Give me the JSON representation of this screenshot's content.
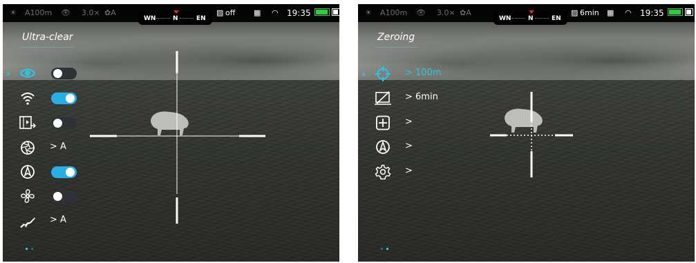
{
  "left": {
    "status": {
      "range": "A100m",
      "zoom": "3.0×",
      "mode": "A",
      "compass": [
        "WN",
        "N",
        "EN"
      ],
      "display_off": "off",
      "time": "19:35"
    },
    "menu_title": "Ultra-clear",
    "rows": [
      {
        "icon": "eye-icon",
        "toggle": "off",
        "selected": true
      },
      {
        "icon": "wifi-icon",
        "toggle": "on"
      },
      {
        "icon": "pip-icon",
        "toggle": "off"
      },
      {
        "icon": "aperture-icon",
        "value": "> A"
      },
      {
        "icon": "compass-icon",
        "toggle": "on"
      },
      {
        "icon": "fan-icon",
        "toggle": "off"
      },
      {
        "icon": "rifle-icon",
        "value": "> A"
      }
    ]
  },
  "right": {
    "status": {
      "range": "A100m",
      "zoom": "3.0×",
      "mode": "A",
      "compass": [
        "WN",
        "N",
        "EN"
      ],
      "display_timer": "6min",
      "time": "19:35"
    },
    "menu_title": "Zeroing",
    "rows": [
      {
        "icon": "crosshair-target-icon",
        "value": "> 100m",
        "selected": true
      },
      {
        "icon": "screen-off-icon",
        "value": "> 6min"
      },
      {
        "icon": "plus-box-icon",
        "value": ">"
      },
      {
        "icon": "compass-icon",
        "value": ">"
      },
      {
        "icon": "settings-gear-icon",
        "value": ">"
      }
    ]
  },
  "colors": {
    "accent": "#29c6e8",
    "toggle_on": "#29aee8",
    "battery": "#2ecc40",
    "compass_marker": "#e0281e"
  }
}
